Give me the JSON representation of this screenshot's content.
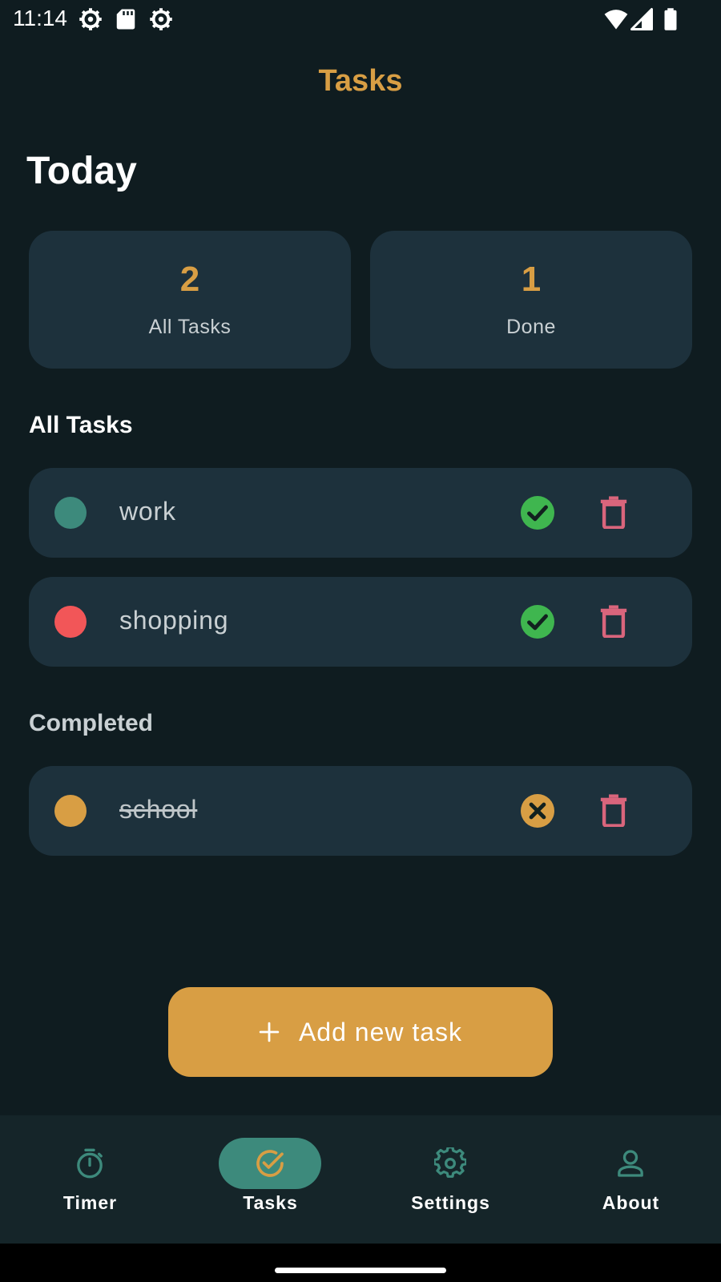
{
  "status_bar": {
    "time": "11:14",
    "icons": [
      "gear-icon",
      "sd-card-icon",
      "gear-icon",
      "wifi-icon",
      "signal-icon",
      "battery-icon"
    ]
  },
  "app_bar": {
    "title": "Tasks"
  },
  "today": {
    "heading": "Today",
    "stats": [
      {
        "value": "2",
        "label": "All Tasks"
      },
      {
        "value": "1",
        "label": "Done"
      }
    ]
  },
  "all_tasks": {
    "heading": "All Tasks",
    "items": [
      {
        "label": "work",
        "dot_color": "#3d8a7c",
        "action": "check-circle-icon",
        "done": false
      },
      {
        "label": "shopping",
        "dot_color": "#f25658",
        "action": "check-circle-icon",
        "done": false
      }
    ]
  },
  "completed": {
    "heading": "Completed",
    "items": [
      {
        "label": "school",
        "dot_color": "#d89e44",
        "action": "cancel-circle-icon",
        "done": true
      }
    ]
  },
  "add_button": {
    "label": "Add new task",
    "icon": "plus-icon"
  },
  "bottom_nav": {
    "items": [
      {
        "label": "Timer",
        "icon": "stopwatch-icon",
        "active": false
      },
      {
        "label": "Tasks",
        "icon": "check-circle-icon",
        "active": true
      },
      {
        "label": "Settings",
        "icon": "gear-icon",
        "active": false
      },
      {
        "label": "About",
        "icon": "person-icon",
        "active": false
      }
    ]
  },
  "colors": {
    "background": "#0f1c20",
    "card": "#1d313c",
    "accent": "#d89e44",
    "teal": "#3d8a7c",
    "check_green": "#3fb64f",
    "delete_pink": "#d9657c"
  }
}
